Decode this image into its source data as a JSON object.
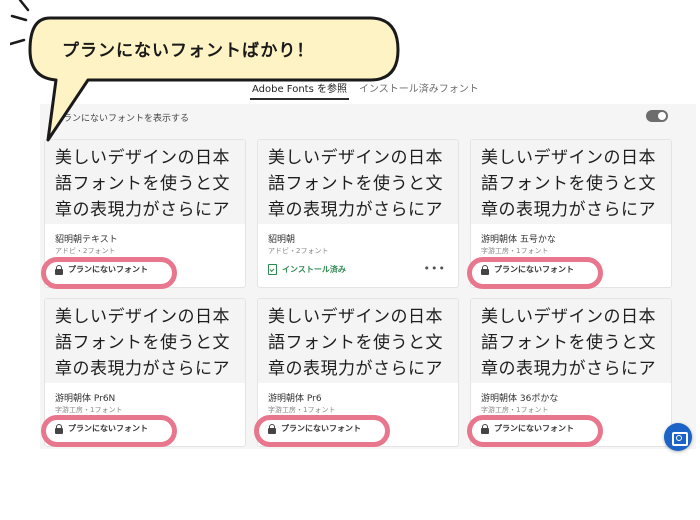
{
  "callout": {
    "text": "プランにないフォントばかり！"
  },
  "tabs": [
    {
      "label": "Adobe Fonts を参照",
      "active": true
    },
    {
      "label": "インストール済みフォント",
      "active": false
    }
  ],
  "filter": {
    "label": "プランにないフォントを表示する",
    "toggle_on": true
  },
  "sample_text": "美しいデザインの日本語フォントを使うと文章の表現力がさらにアップします",
  "cards": [
    {
      "name": "貂明朝テキスト",
      "meta": "アドビ・2フォント",
      "badge": "プランにないフォント",
      "status": "locked"
    },
    {
      "name": "貂明朝",
      "meta": "アドビ・2フォント",
      "badge": "インストール済み",
      "status": "installed",
      "more": "•••"
    },
    {
      "name": "游明朝体 五号かな",
      "meta": "字游工房・1フォント",
      "badge": "プランにないフォント",
      "status": "locked"
    },
    {
      "name": "游明朝体 Pr6N",
      "meta": "字游工房・1フォント",
      "badge": "プランにないフォント",
      "status": "locked"
    },
    {
      "name": "游明朝体 Pr6",
      "meta": "字游工房・1フォント",
      "badge": "プランにないフォント",
      "status": "locked"
    },
    {
      "name": "游明朝体 36ポかな",
      "meta": "字游工房・1フォント",
      "badge": "プランにないフォント",
      "status": "locked"
    }
  ],
  "colors": {
    "highlight": "#e8778d",
    "callout_fill": "#fdf3c4",
    "installed": "#2d8a4e",
    "fab": "#1b63c6"
  },
  "icons": {
    "lock": "lock-icon",
    "installed": "install-check-icon",
    "fab": "feedback-icon"
  }
}
